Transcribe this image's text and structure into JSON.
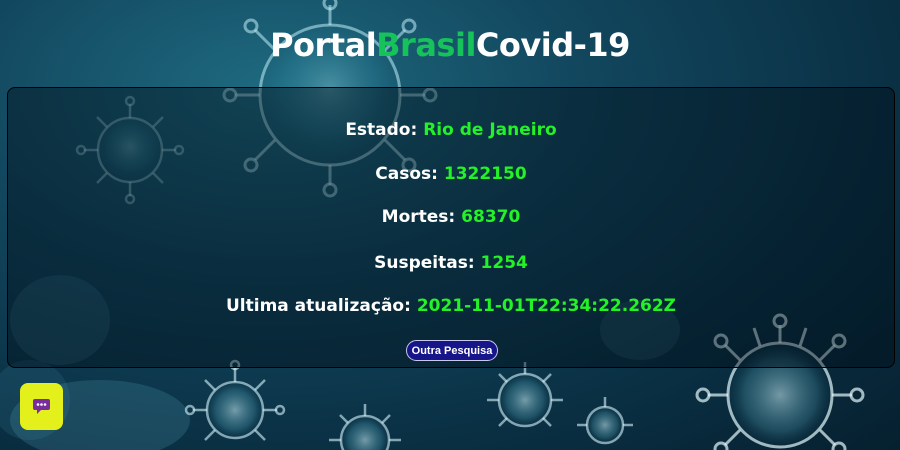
{
  "header": {
    "title_part1": "Portal",
    "title_part2": "Brasil",
    "title_part3": "Covid-19"
  },
  "stats": [
    {
      "label": "Estado:",
      "value": "Rio de Janeiro"
    },
    {
      "label": "Casos:",
      "value": "1322150"
    },
    {
      "label": "Mortes:",
      "value": "68370"
    },
    {
      "label": "Suspeitas:",
      "value": "1254"
    },
    {
      "label": "Ultima atualização:",
      "value": "2021-11-01T22:34:22.262Z"
    }
  ],
  "actions": {
    "other_search_label": "Outra Pesquisa"
  },
  "chat_widget": {
    "icon": "chat-bubble-icon"
  },
  "colors": {
    "accent_green": "#16c25a",
    "value_green": "#23f227",
    "button_blue": "#16168a",
    "chat_yellow": "#e3f01c"
  }
}
